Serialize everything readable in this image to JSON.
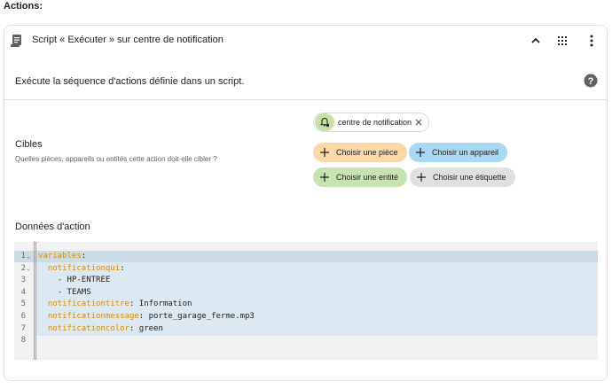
{
  "heading": "Actions:",
  "card": {
    "title": "Script « Exécuter » sur centre de notification",
    "description": "Exécute la séquence d'actions définie dans un script."
  },
  "targets": {
    "label": "Cibles",
    "help": "Quelles pièces, appareils ou entités cette action doit-elle cibler ?",
    "selected": {
      "label": "centre de notification",
      "color": "#c5e1a5"
    },
    "buttons": [
      {
        "label": "Choisir une pièce",
        "color": "#fcd7a8"
      },
      {
        "label": "Choisir un appareil",
        "color": "#a8d8f4"
      },
      {
        "label": "Choisir une entité",
        "color": "#c7e3b0"
      },
      {
        "label": "Choisir une étiquette",
        "color": "#e0e0e0"
      }
    ]
  },
  "action_data": {
    "label": "Données d'action",
    "lines": [
      {
        "num": "1",
        "fold": true,
        "indent": "",
        "key": "variables",
        "sep": ":",
        "value": ""
      },
      {
        "num": "2",
        "fold": true,
        "indent": "  ",
        "key": "notificationqui",
        "sep": ":",
        "value": ""
      },
      {
        "num": "3",
        "fold": false,
        "indent": "    ",
        "key": "",
        "sep": "",
        "value": "- HP-ENTREE"
      },
      {
        "num": "4",
        "fold": false,
        "indent": "    ",
        "key": "",
        "sep": "",
        "value": "- TEAMS"
      },
      {
        "num": "5",
        "fold": false,
        "indent": "  ",
        "key": "notificationtitre",
        "sep": ": ",
        "value": "Information"
      },
      {
        "num": "6",
        "fold": false,
        "indent": "  ",
        "key": "notificationmessage",
        "sep": ": ",
        "value": "porte_garage_ferme.mp3"
      },
      {
        "num": "7",
        "fold": false,
        "indent": "  ",
        "key": "notificationcolor",
        "sep": ": ",
        "value": "green"
      },
      {
        "num": "8",
        "fold": false,
        "indent": "",
        "key": "",
        "sep": "",
        "value": ""
      }
    ]
  },
  "icons": {
    "script": "script-icon",
    "collapse": "chevron-up-icon",
    "drag": "drag-handle-icon",
    "menu": "more-vertical-icon",
    "help": "help-circle-icon",
    "bell": "bell-cog-icon",
    "remove": "close-icon",
    "add": "plus-icon"
  }
}
